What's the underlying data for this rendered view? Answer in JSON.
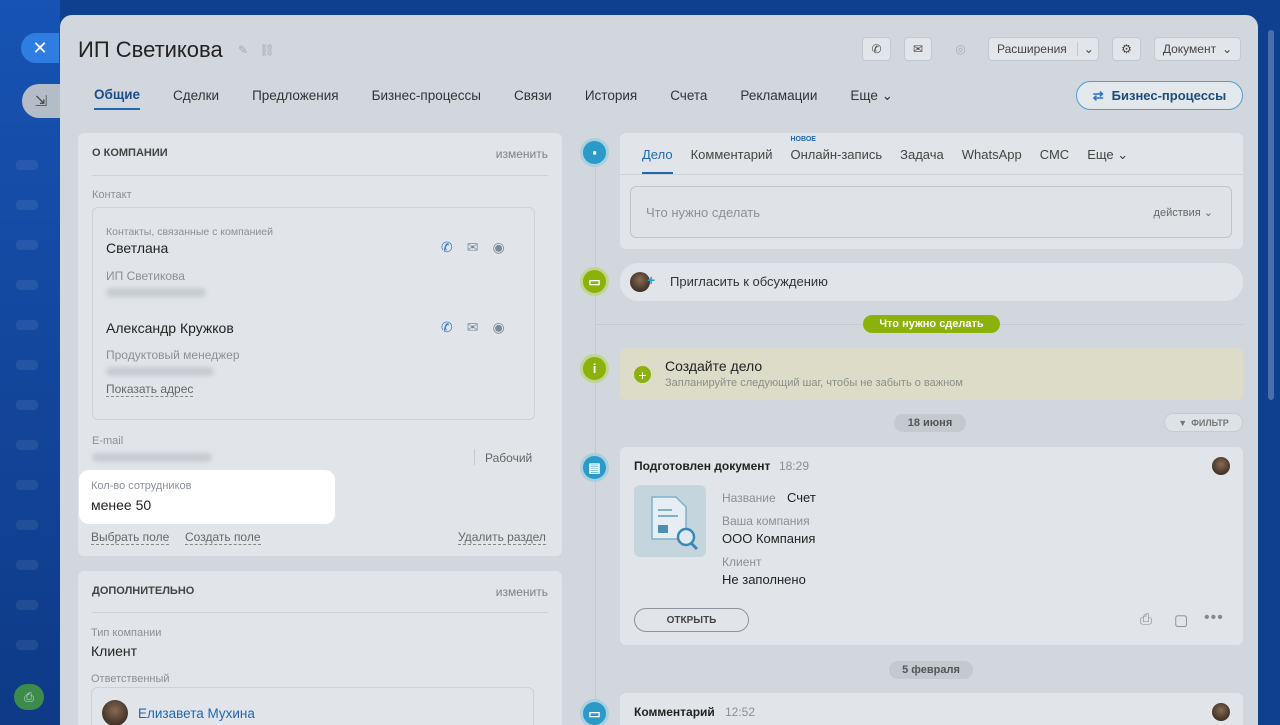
{
  "header": {
    "title": "ИП Светикова",
    "extensions_label": "Расширения",
    "document_label": "Документ"
  },
  "tabs": [
    {
      "label": "Общие"
    },
    {
      "label": "Сделки"
    },
    {
      "label": "Предложения"
    },
    {
      "label": "Бизнес-процессы"
    },
    {
      "label": "Связи"
    },
    {
      "label": "История"
    },
    {
      "label": "Счета"
    },
    {
      "label": "Рекламации"
    },
    {
      "label": "Еще"
    }
  ],
  "bp_button": "Бизнес-процессы",
  "about": {
    "title": "О КОМПАНИИ",
    "edit": "изменить",
    "contact_label": "Контакт",
    "contacts_caption": "Контакты, связанные с компанией",
    "contact1": {
      "name": "Светлана",
      "company": "ИП Светикова"
    },
    "contact2": {
      "name": "Александр Кружков",
      "role": "Продуктовый менеджер",
      "show_address": "Показать адрес"
    },
    "email_label": "E-mail",
    "email_type": "Рабочий",
    "employees_label": "Кол-во сотрудников",
    "employees_value": "менее 50",
    "choose_field": "Выбрать поле",
    "create_field": "Создать поле",
    "delete_section": "Удалить раздел"
  },
  "additional": {
    "title": "ДОПОЛНИТЕЛЬНО",
    "edit": "изменить",
    "type_label": "Тип компании",
    "type_value": "Клиент",
    "resp_label": "Ответственный",
    "resp_value": "Елизавета Мухина"
  },
  "activity": {
    "tabs": [
      {
        "label": "Дело"
      },
      {
        "label": "Комментарий"
      },
      {
        "label": "Онлайн-запись"
      },
      {
        "label": "Задача"
      },
      {
        "label": "WhatsApp"
      },
      {
        "label": "СМС"
      },
      {
        "label": "Еще"
      }
    ],
    "new_badge": "НОВОЕ",
    "placeholder": "Что нужно сделать",
    "actions": "действия"
  },
  "invite": "Пригласить к обсуждению",
  "todo_pill": "Что нужно сделать",
  "create_task": {
    "title": "Создайте дело",
    "subtitle": "Запланируйте следующий шаг, чтобы не забыть о важном"
  },
  "date1": "18 июня",
  "filter": "ФИЛЬТР",
  "doc": {
    "title": "Подготовлен документ",
    "time": "18:29",
    "name_label": "Название",
    "name_value": "Счет",
    "company_label": "Ваша компания",
    "company_value": "ООО Компания",
    "client_label": "Клиент",
    "client_value": "Не заполнено",
    "open_btn": "ОТКРЫТЬ"
  },
  "date2": "5 февраля",
  "comment": {
    "title": "Комментарий",
    "time": "12:52"
  },
  "colors": {
    "accent": "#2067b0",
    "green": "#8bb20a",
    "timeline_blue": "#2b9ac9"
  }
}
